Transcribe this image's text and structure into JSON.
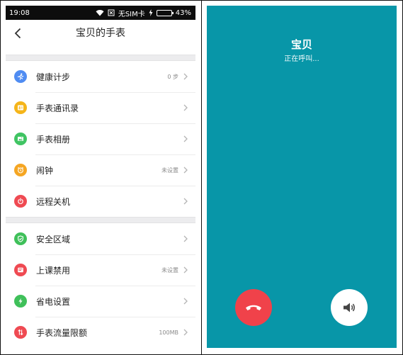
{
  "status_bar": {
    "time": "19:08",
    "sim": "无SIM卡",
    "battery": "43%",
    "battery_level": 0.43,
    "icons": [
      "wifi-icon",
      "no-sim-icon",
      "charging-icon",
      "battery-icon"
    ]
  },
  "header": {
    "title": "宝贝的手表",
    "back_icon": "chevron-left-icon"
  },
  "groups": [
    {
      "items": [
        {
          "label": "健康计步",
          "value": "0 步",
          "icon": "running-icon",
          "color": "#4f8cf2"
        },
        {
          "label": "手表通讯录",
          "value": "",
          "icon": "contacts-icon",
          "color": "#f5b51a"
        },
        {
          "label": "手表相册",
          "value": "",
          "icon": "photo-icon",
          "color": "#40c463"
        },
        {
          "label": "闹钟",
          "value": "未设置",
          "icon": "alarm-icon",
          "color": "#f5a623"
        },
        {
          "label": "远程关机",
          "value": "",
          "icon": "power-icon",
          "color": "#ef4a52"
        }
      ]
    },
    {
      "items": [
        {
          "label": "安全区域",
          "value": "",
          "icon": "shield-icon",
          "color": "#3fc05a"
        },
        {
          "label": "上课禁用",
          "value": "未设置",
          "icon": "class-disable-icon",
          "color": "#ef4a52"
        },
        {
          "label": "省电设置",
          "value": "",
          "icon": "lightning-icon",
          "color": "#3fc05a"
        },
        {
          "label": "手表流量限额",
          "value": "100MB",
          "icon": "data-transfer-icon",
          "color": "#ef4a52"
        }
      ]
    }
  ],
  "call": {
    "name": "宝贝",
    "status": "正在呼叫...",
    "background": "#0896a8",
    "hangup_icon": "phone-hangup-icon",
    "hangup_color": "#f0424a",
    "speaker_icon": "speaker-icon"
  }
}
